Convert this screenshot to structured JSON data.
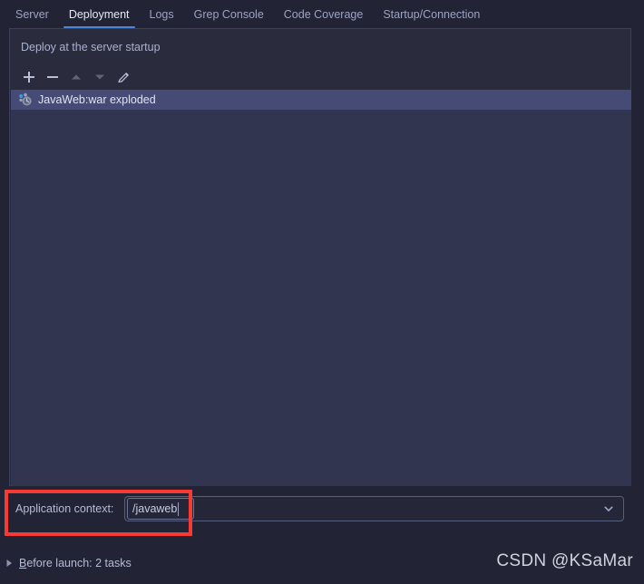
{
  "colors": {
    "window_bg": "#222335",
    "panel_bg": "#2a2c3e",
    "list_bg": "#31354f",
    "selection": "#464b75",
    "accent_tab_underline": "#4a88df",
    "annotation_red": "#f93a33",
    "text_primary": "#e6eaf5",
    "text_muted": "#9aa4c4"
  },
  "tabs": [
    {
      "label": "Server",
      "active": false,
      "name": "tab-server"
    },
    {
      "label": "Deployment",
      "active": true,
      "name": "tab-deployment"
    },
    {
      "label": "Logs",
      "active": false,
      "name": "tab-logs"
    },
    {
      "label": "Grep Console",
      "active": false,
      "name": "tab-grep-console"
    },
    {
      "label": "Code Coverage",
      "active": false,
      "name": "tab-code-coverage"
    },
    {
      "label": "Startup/Connection",
      "active": false,
      "name": "tab-startup-connection"
    }
  ],
  "deployment_panel": {
    "label": "Deploy at the server startup",
    "toolbar": [
      {
        "name": "add-button",
        "icon": "plus-icon",
        "tooltip": "Add"
      },
      {
        "name": "remove-button",
        "icon": "minus-icon",
        "tooltip": "Remove"
      },
      {
        "name": "move-up-button",
        "icon": "arrow-up-icon",
        "tooltip": "Move Up",
        "enabled": false
      },
      {
        "name": "move-down-button",
        "icon": "arrow-down-icon",
        "tooltip": "Move Down",
        "enabled": false
      },
      {
        "name": "edit-button",
        "icon": "pencil-icon",
        "tooltip": "Edit"
      }
    ],
    "artifacts": [
      {
        "label": "JavaWeb:war exploded",
        "icon": "artifact-exploded-icon",
        "selected": true
      }
    ]
  },
  "application_context": {
    "label": "Application context:",
    "value": "/javaweb",
    "placeholder": "",
    "dropdown_icon": "chevron-down-icon"
  },
  "before_launch": {
    "expander_icon": "triangle-right-icon",
    "mnemonic": "B",
    "label_rest": "efore launch: 2 tasks",
    "full_label": "Before launch: 2 tasks"
  },
  "watermark": {
    "text": "CSDN @KSaMar"
  }
}
